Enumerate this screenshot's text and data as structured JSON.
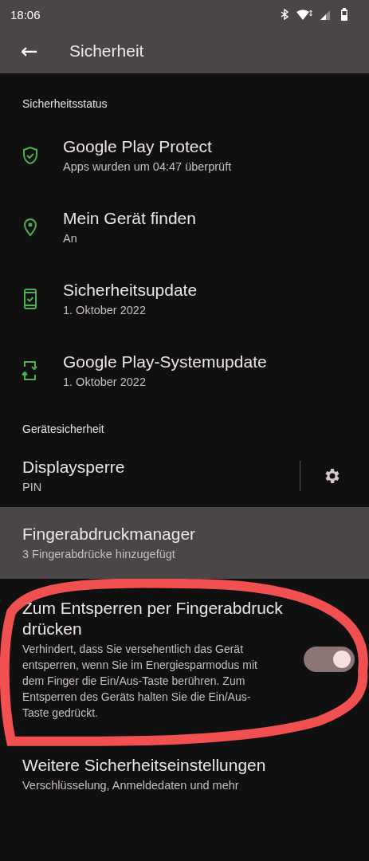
{
  "status_bar": {
    "time": "18:06"
  },
  "app_bar": {
    "back": "←",
    "title": "Sicherheit"
  },
  "sections": [
    {
      "header": "Sicherheitsstatus",
      "items": [
        {
          "kind": "status",
          "title": "Google Play Protect",
          "subtitle": "Apps wurden um 04:47 überprüft"
        },
        {
          "kind": "status",
          "title": "Mein Gerät finden",
          "subtitle": "An"
        },
        {
          "kind": "status",
          "title": "Sicherheitsupdate",
          "subtitle": "1. Oktober 2022"
        },
        {
          "kind": "status",
          "title": "Google Play-Systemupdate",
          "subtitle": "1. Oktober 2022"
        }
      ]
    },
    {
      "header": "Gerätesicherheit",
      "items": [
        {
          "kind": "gear",
          "title": "Displaysperre",
          "subtitle": "PIN"
        },
        {
          "kind": "plain",
          "selected": true,
          "title": "Fingerabdruckmanager",
          "subtitle": "3 Fingerabdrücke hinzugefügt"
        },
        {
          "kind": "switch",
          "on": true,
          "title": "Zum Entsperren per Fingerabdruck drücken",
          "subtitle": "Verhindert, dass Sie versehentlich das Gerät entsperren, wenn Sie im Energiesparmodus mit dem Finger die Ein/Aus-Taste berühren. Zum Entsperren des Geräts halten Sie die Ein/Aus-Taste gedrückt."
        },
        {
          "kind": "plain",
          "selected": false,
          "title": "Weitere Sicherheitseinstellungen",
          "subtitle": "Verschlüsselung, Anmeldedaten und mehr"
        }
      ]
    }
  ]
}
